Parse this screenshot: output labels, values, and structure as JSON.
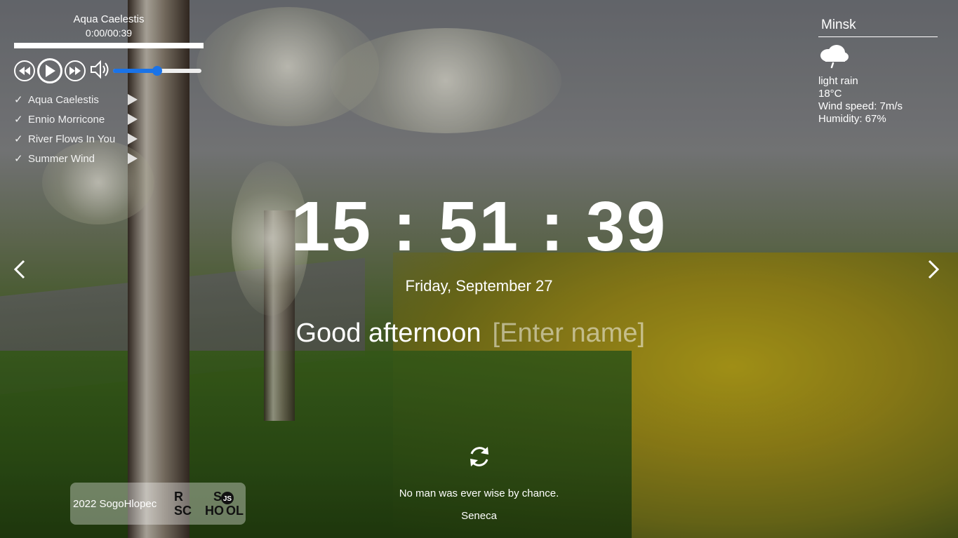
{
  "player": {
    "title": "Aqua Caelestis",
    "time": "0:00/00:39",
    "progress": 0,
    "volume": 0.5,
    "playlist": [
      {
        "label": "Aqua Caelestis"
      },
      {
        "label": "Ennio Morricone"
      },
      {
        "label": "River Flows In You"
      },
      {
        "label": "Summer Wind"
      }
    ],
    "check_glyph": "✓"
  },
  "weather": {
    "city": "Minsk",
    "icon": "rain-cloud-icon",
    "description": "light rain",
    "temperature": "18°C",
    "wind": "Wind speed: 7m/s",
    "humidity": "Humidity: 67%"
  },
  "clock": {
    "time": "15 : 51 : 39",
    "date": "Friday, September 27"
  },
  "greeting": {
    "text": "Good afternoon",
    "name_placeholder": "[Enter name]"
  },
  "quote": {
    "text": "No man was ever wise by chance.",
    "author": "Seneca"
  },
  "footer": {
    "copyright": "2022 SogoHlopec",
    "logo_text": "RS SCHOOL"
  },
  "colors": {
    "accent": "#1a73e8"
  }
}
